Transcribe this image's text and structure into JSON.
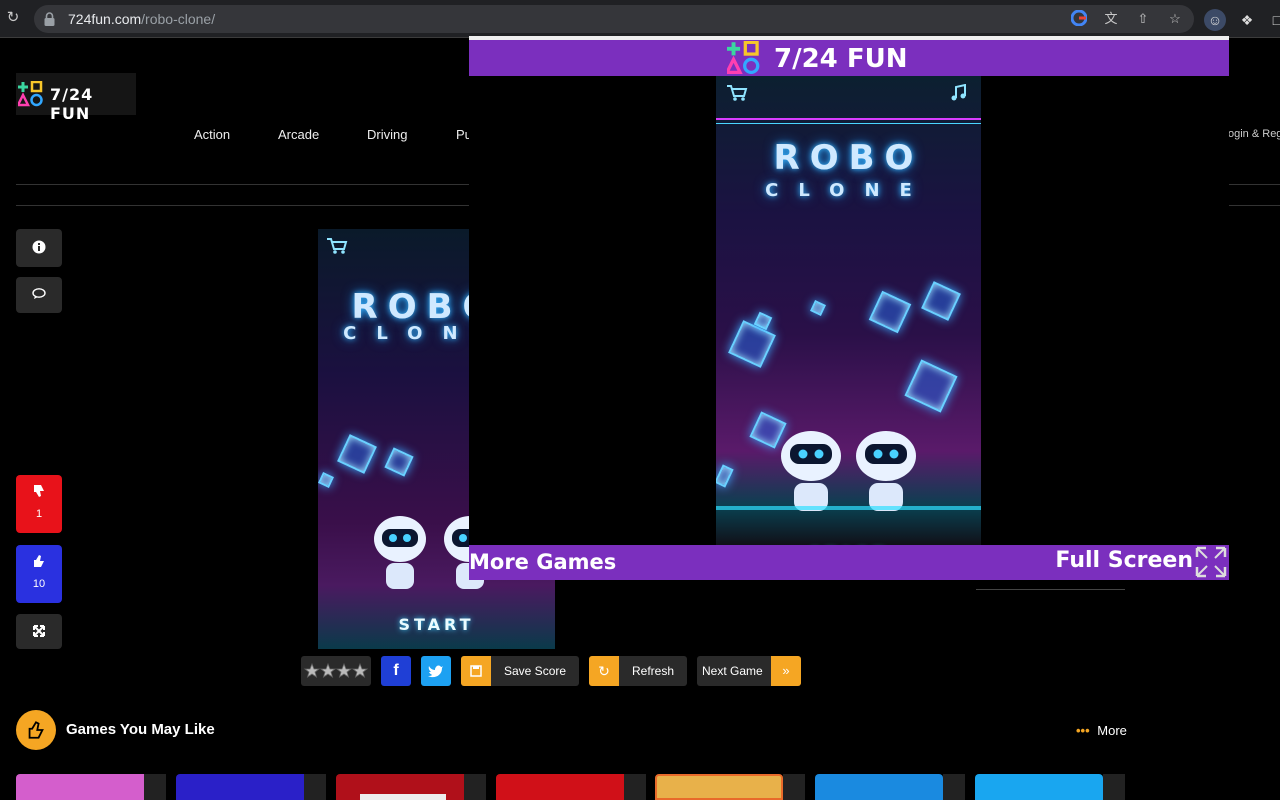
{
  "browser": {
    "url_host": "724fun.com",
    "url_path": "/robo-clone/"
  },
  "site": {
    "logo_text": "7/24 FUN",
    "nav": [
      "Action",
      "Arcade",
      "Driving",
      "Pu"
    ],
    "login": "ogin & Reg"
  },
  "side": {
    "dislike_count": "1",
    "like_count": "10"
  },
  "game": {
    "title_line1": "ROBO",
    "title_line2": "CLONE",
    "start": "START"
  },
  "popup": {
    "title": "7/24 FUN",
    "more_games": "More Games",
    "full_screen": "Full Screen"
  },
  "toolbar": {
    "save_score": "Save Score",
    "refresh": "Refresh",
    "next_game": "Next Game"
  },
  "section": {
    "title": "Games You May Like",
    "more": "More"
  },
  "colors": {
    "accent_purple": "#7b2fbe",
    "orange": "#f5a623",
    "dislike_red": "#e8121a",
    "like_blue": "#2a31e0",
    "facebook": "#1f3fd6",
    "twitter": "#1da1f2"
  }
}
